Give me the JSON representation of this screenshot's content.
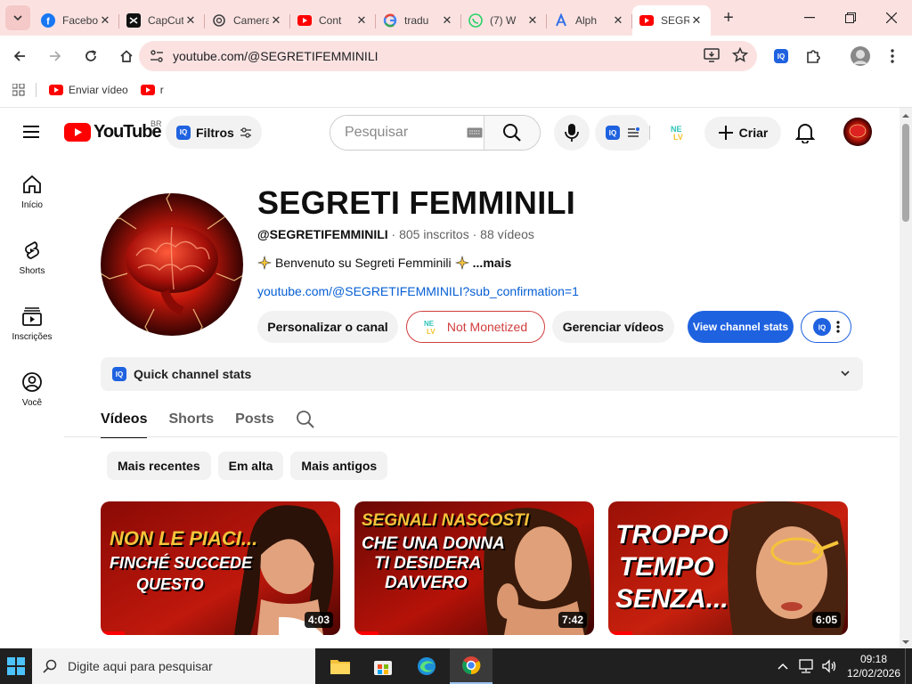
{
  "browser": {
    "tabs": [
      {
        "title": "Facebook",
        "icon": "facebook-icon"
      },
      {
        "title": "CapCut",
        "icon": "capcut-icon"
      },
      {
        "title": "Camera",
        "icon": "openai-icon"
      },
      {
        "title": "Cont",
        "icon": "youtube-icon"
      },
      {
        "title": "tradu",
        "icon": "google-icon"
      },
      {
        "title": "(7) W",
        "icon": "whatsapp-icon"
      },
      {
        "title": "Alph",
        "icon": "alpha-icon"
      },
      {
        "title": "SEGRETI",
        "icon": "youtube-icon",
        "active": true
      }
    ],
    "address": "youtube.com/@SEGRETIFEMMINILI",
    "bookmarks": [
      {
        "label": "Enviar vídeo"
      },
      {
        "label": "r"
      }
    ]
  },
  "masthead": {
    "logo_text": "YouTube",
    "country_code": "BR",
    "filters_label": "Filtros",
    "search_placeholder": "Pesquisar",
    "create_label": "Criar"
  },
  "guide": [
    {
      "label": "Início",
      "icon": "home-icon"
    },
    {
      "label": "Shorts",
      "icon": "shorts-icon"
    },
    {
      "label": "Inscrições",
      "icon": "subscriptions-icon"
    },
    {
      "label": "Você",
      "icon": "you-icon"
    }
  ],
  "channel": {
    "title": "SEGRETI FEMMINILI",
    "handle": "@SEGRETIFEMMINILI",
    "subscribers": "805 inscritos",
    "videos": "88 vídeos",
    "description": "Benvenuto su Segreti Femminili",
    "more": "...mais",
    "link": "youtube.com/@SEGRETIFEMMINILI?sub_confirmation=1",
    "buttons": {
      "customize": "Personalizar o canal",
      "monetized": "Not Monetized",
      "manage": "Gerenciar vídeos",
      "stats": "View channel stats"
    },
    "quick_stats": "Quick channel stats",
    "tabs": [
      "Vídeos",
      "Shorts",
      "Posts"
    ],
    "chips": [
      "Mais recentes",
      "Em alta",
      "Mais antigos"
    ]
  },
  "videos": [
    {
      "thumb_line1": "NON LE PIACI...",
      "thumb_line2": "FINCHÉ SUCCEDE",
      "thumb_line3": "QUESTO",
      "duration": "4:03",
      "watched": 0.1
    },
    {
      "thumb_line1": "SEGNALI NASCOSTI",
      "thumb_line2": "CHE UNA DONNA",
      "thumb_line3": "TI DESIDERA",
      "thumb_line4": "DAVVERO",
      "duration": "7:42",
      "watched": 0.1
    },
    {
      "thumb_line1": "TROPPO",
      "thumb_line2": "TEMPO",
      "thumb_line3": "SENZA...",
      "duration": "6:05",
      "watched": 0.1
    }
  ],
  "taskbar": {
    "search_placeholder": "Digite aqui para pesquisar",
    "time": "09:18",
    "date": "12/02/2026"
  },
  "colors": {
    "chrome_tint": "#fbe2e1",
    "yt_red": "#ff0000",
    "link_blue": "#065fd4",
    "iq_blue": "#1f62e0",
    "not_monetized_red": "#d13d3d"
  }
}
